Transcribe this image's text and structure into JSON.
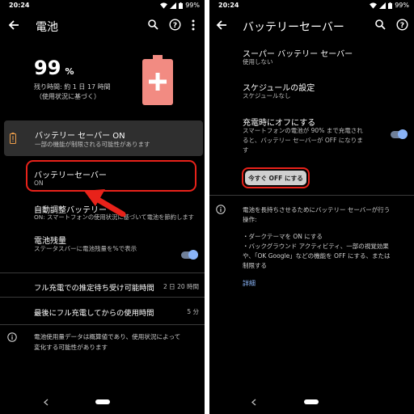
{
  "left": {
    "status": {
      "time": "20:24",
      "battery_pct": "99%"
    },
    "appbar": {
      "title": "電池"
    },
    "summary": {
      "percent_value": "99",
      "percent_unit": "%",
      "remaining": "残り時間: 約 1 日 17 時間",
      "basis": "（使用状況に基づく）"
    },
    "warning_card": {
      "title": "バッテリー セーバー ON",
      "subtitle": "一部の機能が制限される可能性があります"
    },
    "items": {
      "saver": {
        "title": "バッテリーセーバー",
        "subtitle": "ON"
      },
      "adaptive": {
        "title": "自動調整バッテリー",
        "subtitle": "ON: スマートフォンの使用状況に基づいて電池を節約します"
      },
      "percentage": {
        "title": "電池残量",
        "subtitle": "ステータスバーに電池残量を%で表示",
        "toggle_on": true
      }
    },
    "stats": [
      {
        "label": "フル充電での推定待ち受け可能時間",
        "value": "2 日 20 時間"
      },
      {
        "label": "最後にフル充電してからの使用時間",
        "value": "5 分"
      }
    ],
    "footer_info": [
      "電池使用量データは概算値であり、使用状況によって",
      "変化する可能性があります"
    ],
    "accent_color": "#e8221a",
    "battery_icon_color": "#f28b82"
  },
  "right": {
    "status": {
      "time": "20:24",
      "battery_pct": "99%"
    },
    "appbar": {
      "title": "バッテリーセーバー"
    },
    "items": {
      "super_saver": {
        "title": "スーパー バッテリー セーバー",
        "subtitle": "使用しない"
      },
      "schedule": {
        "title": "スケジュールの設定",
        "subtitle": "スケジュールなし"
      },
      "turn_off_when_charged": {
        "title": "充電時にオフにする",
        "subtitle_lines": [
          "スマートフォンの電池が 90% まで充電され",
          "ると、バッテリー セーバーが OFF になりま",
          "す"
        ],
        "toggle_on": true
      }
    },
    "turn_off_button": "今すぐ OFF にする",
    "info": {
      "lines": [
        "電池を長持ちさせるためにバッテリー セーバーが行う",
        "操作:"
      ],
      "bullets": [
        "・ダークテーマを ON にする",
        "・バックグラウンド アクティビティ、一部の視覚効果",
        "や、「OK Google」などの機能を OFF にする、または",
        "制限する"
      ],
      "link": "詳細"
    },
    "accent_color": "#8ab4f8"
  }
}
